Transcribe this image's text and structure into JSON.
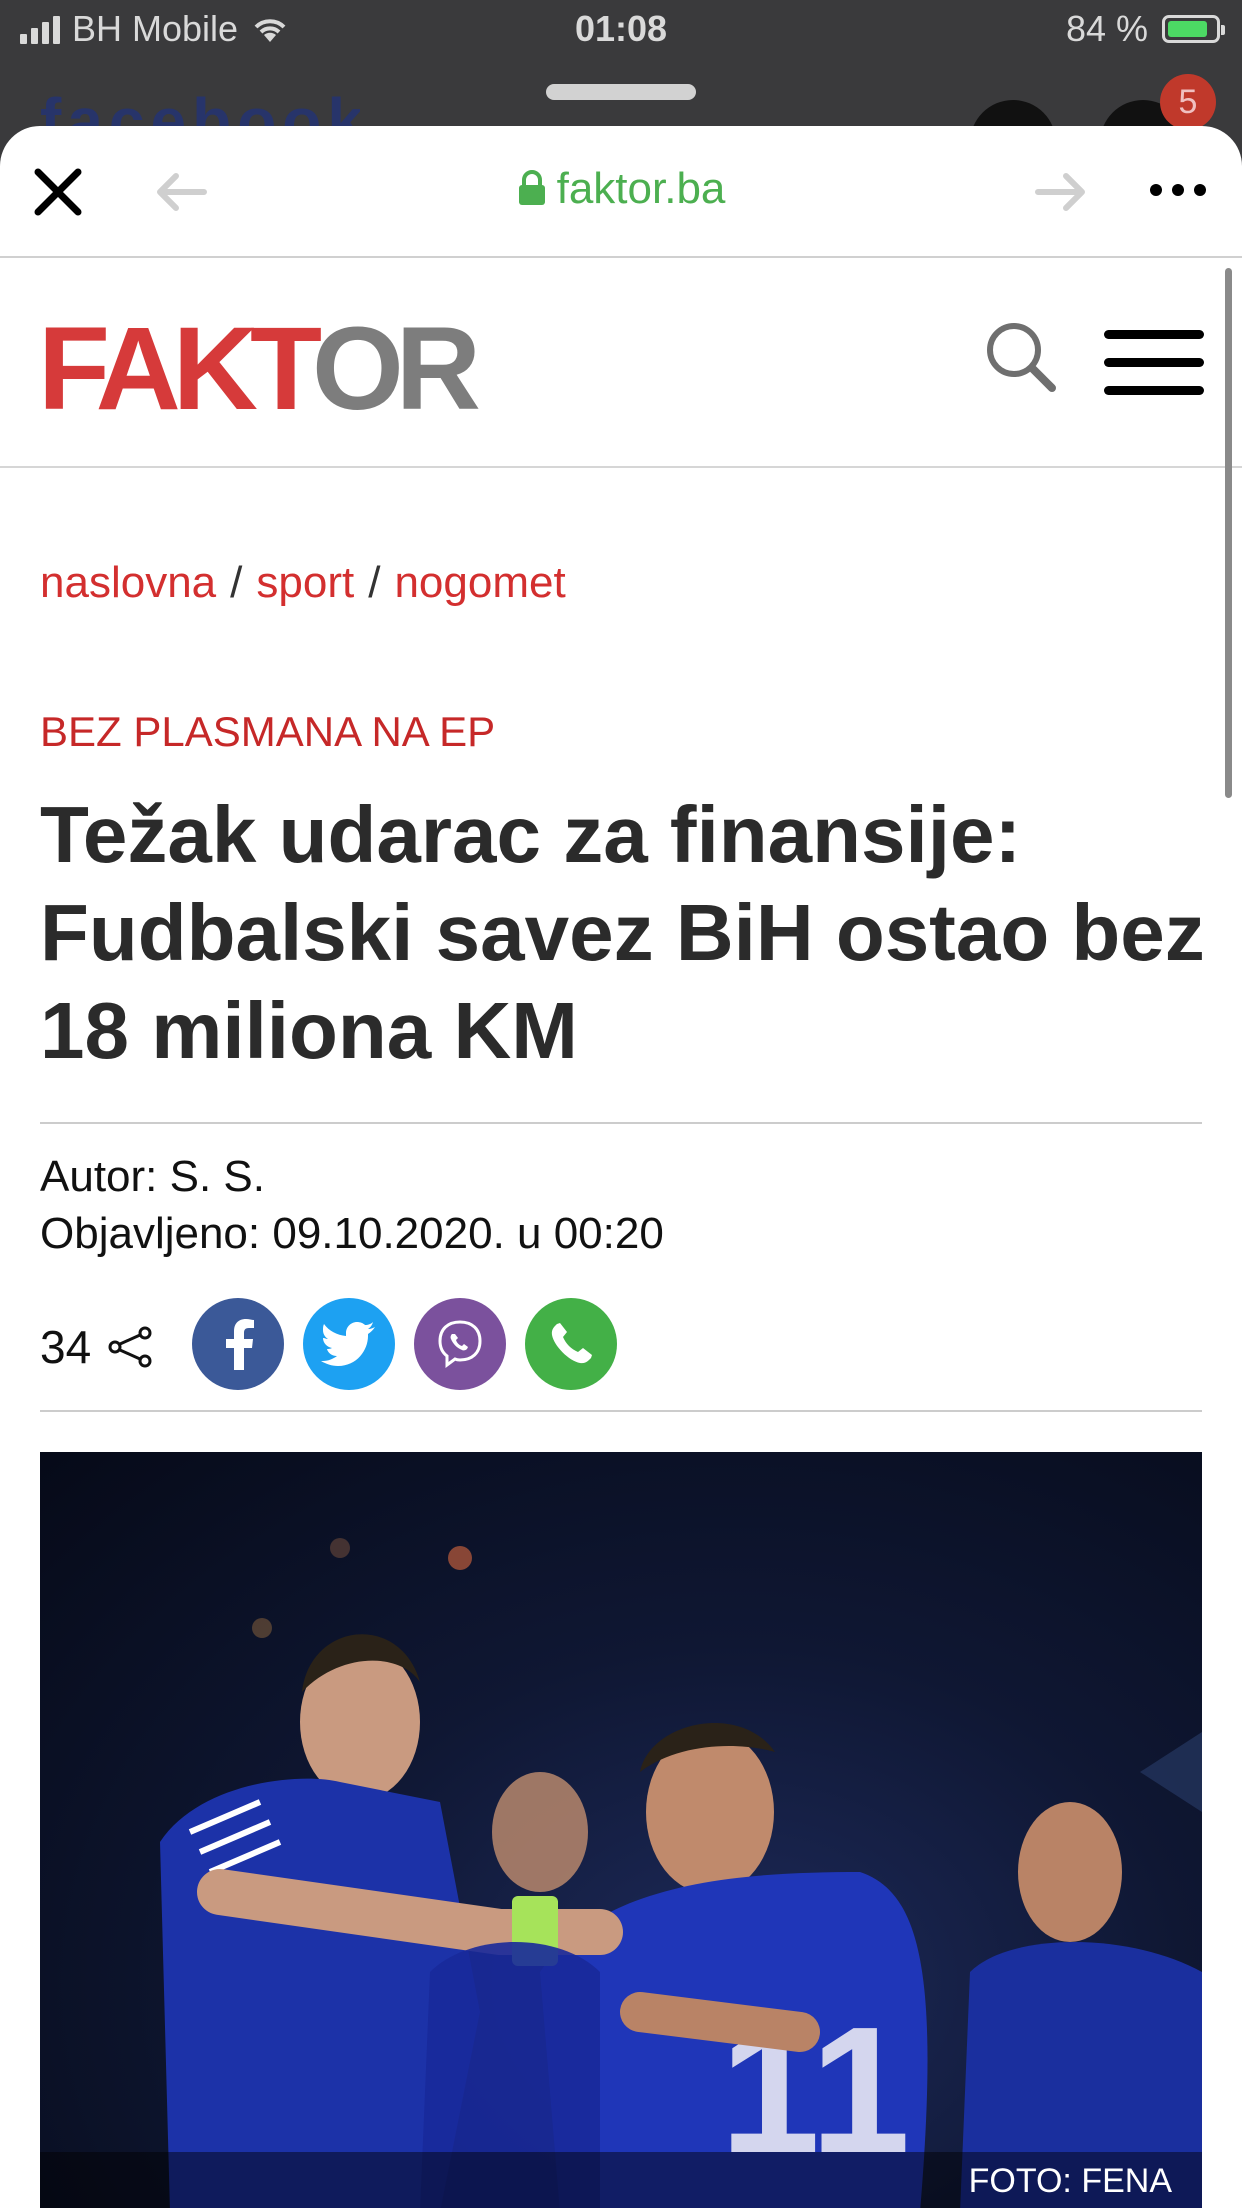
{
  "status_bar": {
    "carrier": "BH Mobile",
    "time": "01:08",
    "battery_text": "84 %",
    "battery_level": 0.84
  },
  "backdrop": {
    "badge_count": "5"
  },
  "browser": {
    "url": "faktor.ba"
  },
  "site": {
    "logo_red": "FAKT",
    "logo_grey": "OR"
  },
  "breadcrumb": {
    "items": [
      "naslovna",
      "sport",
      "nogomet"
    ],
    "separator": "/"
  },
  "article": {
    "kicker": "BEZ PLASMANA NA EP",
    "headline": "Težak udarac za finansije: Fudbalski savez BiH ostao bez 18 miliona KM",
    "author": "Autor: S. S.",
    "published": "Objavljeno: 09.10.2020. u 00:20",
    "share_count": "34",
    "photo_credit": "FOTO: FENA"
  },
  "colors": {
    "brand_red": "#d63a3a",
    "brand_grey": "#7d7d7d",
    "link_red": "#d32f2f",
    "url_green": "#4caf50",
    "facebook": "#3b5998",
    "twitter": "#1da1f2",
    "viber": "#7b519d",
    "whatsapp": "#43b047"
  }
}
